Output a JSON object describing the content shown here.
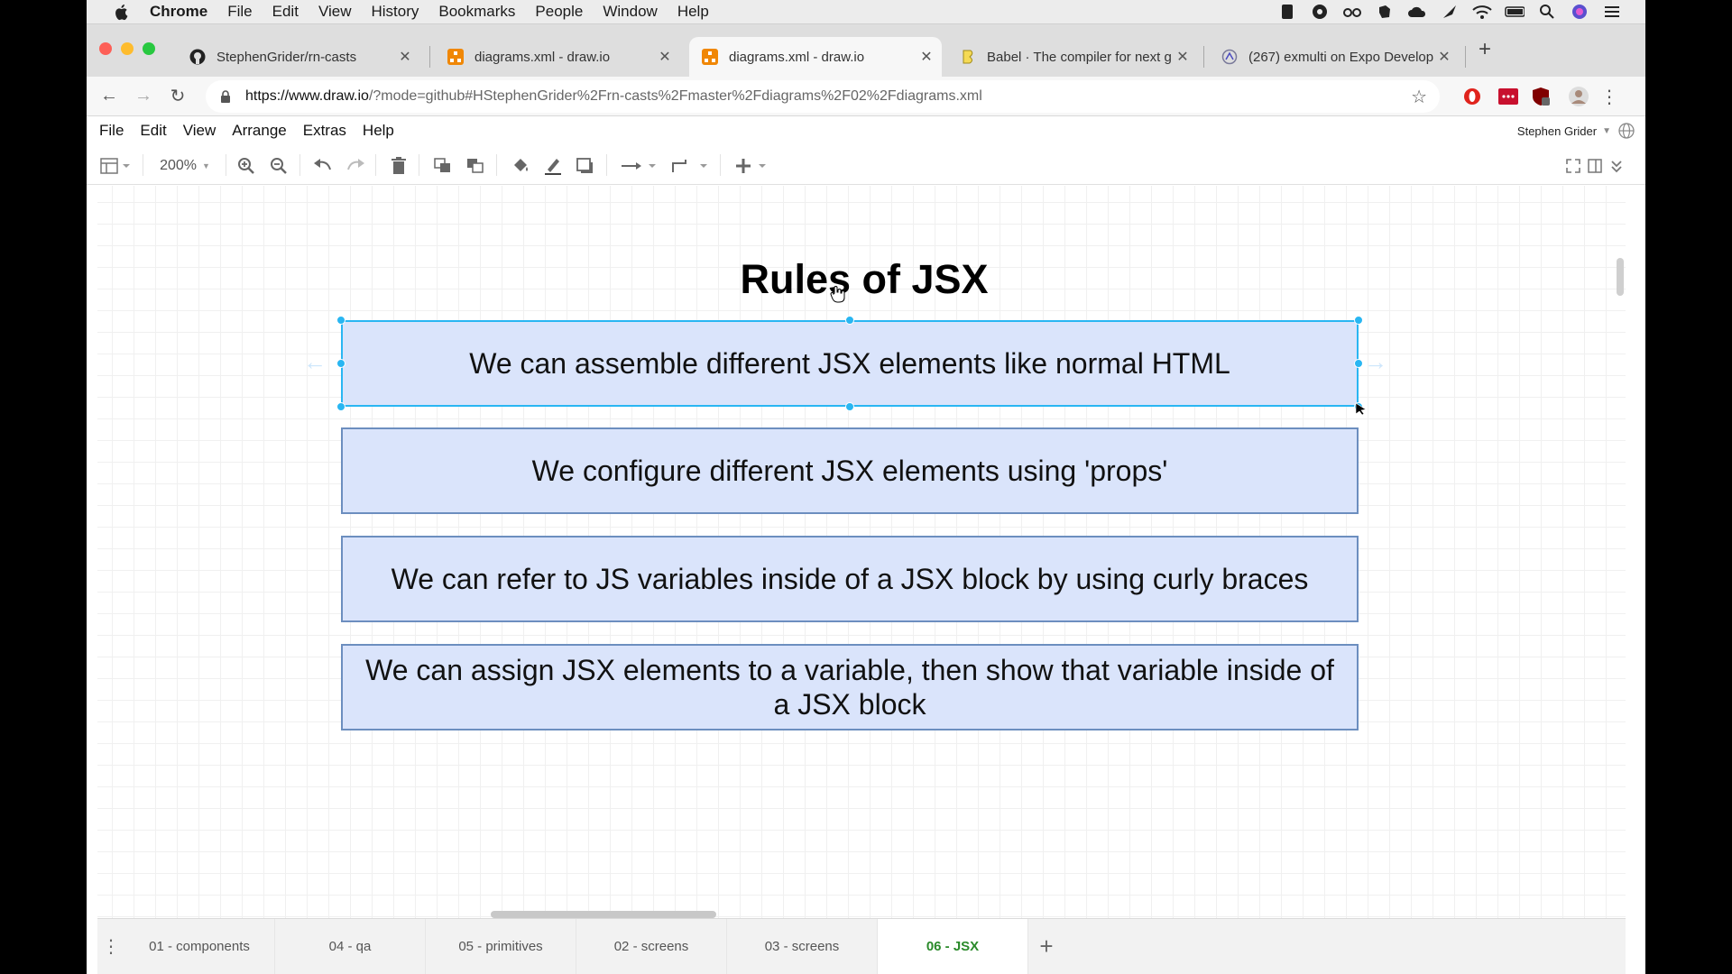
{
  "os_menu": {
    "app": "Chrome",
    "items": [
      "File",
      "Edit",
      "View",
      "History",
      "Bookmarks",
      "People",
      "Window",
      "Help"
    ]
  },
  "browser": {
    "tabs": [
      {
        "title": "StephenGrider/rn-casts",
        "icon": "github-icon",
        "active": false
      },
      {
        "title": "diagrams.xml - draw.io",
        "icon": "drawio-icon",
        "active": false
      },
      {
        "title": "diagrams.xml - draw.io",
        "icon": "drawio-icon",
        "active": true
      },
      {
        "title": "Babel · The compiler for next g",
        "icon": "babel-icon",
        "active": false
      },
      {
        "title": "(267) exmulti on Expo Develop",
        "icon": "expo-icon",
        "active": false
      }
    ],
    "url_host": "https://www.draw.io",
    "url_rest": "/?mode=github#HStephenGrider%2Frn-casts%2Fmaster%2Fdiagrams%2F02%2Fdiagrams.xml"
  },
  "app_menu": {
    "items": [
      "File",
      "Edit",
      "View",
      "Arrange",
      "Extras",
      "Help"
    ],
    "user": "Stephen Grider"
  },
  "toolbar": {
    "zoom": "200%"
  },
  "diagram": {
    "title": "Rules of JSX",
    "rules": [
      "We can assemble different JSX elements like normal HTML",
      "We configure different JSX elements using 'props'",
      "We can refer to JS variables inside of a JSX block by using curly braces",
      "We can assign JSX elements to a variable, then show that variable inside of a JSX block"
    ],
    "box_fill": "#dae4fb",
    "box_stroke": "#6c8ebf",
    "selection_color": "#29b6f2"
  },
  "pages": {
    "tabs": [
      "01 - components",
      "04 - qa",
      "05 - primitives",
      "02 - screens",
      "03 - screens",
      "06 - JSX"
    ],
    "active_color": "#2a8a2a"
  }
}
